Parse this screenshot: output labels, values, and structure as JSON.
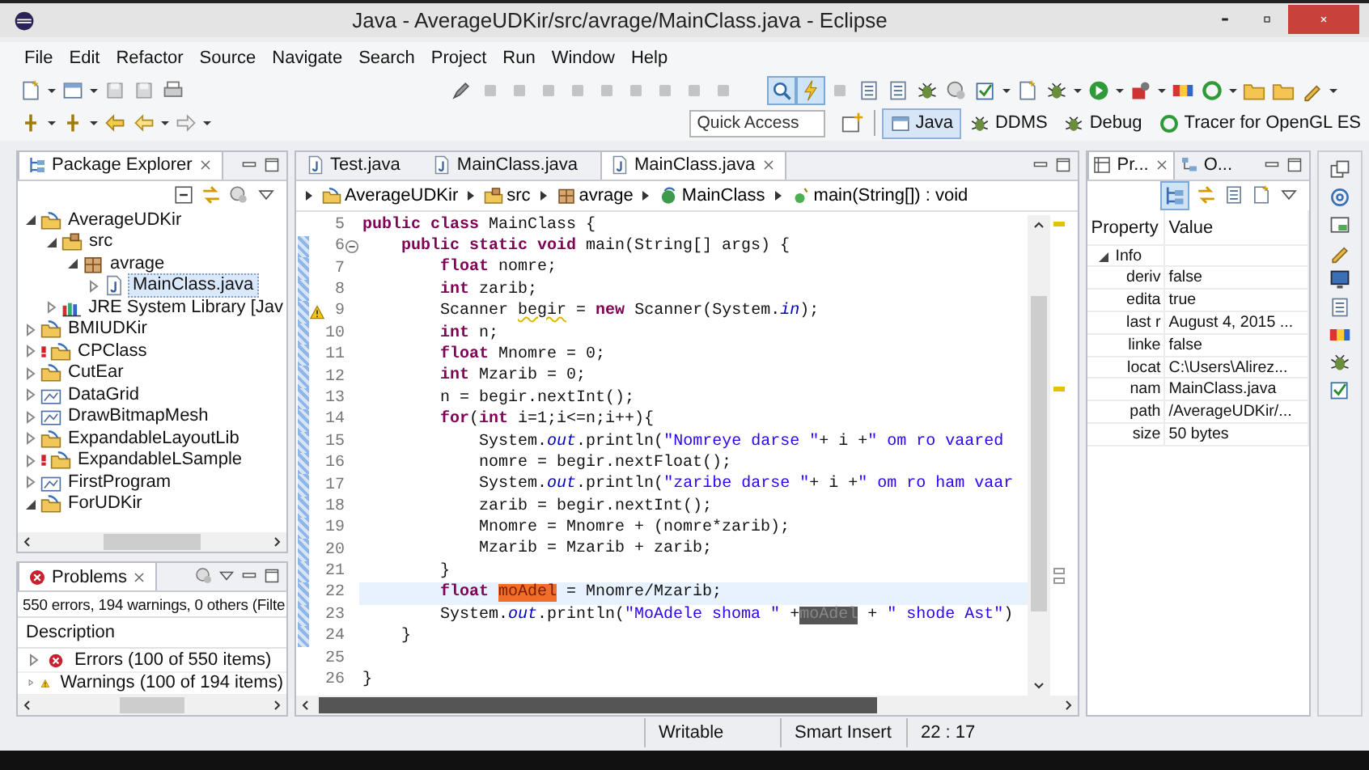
{
  "window": {
    "title": "Java - AverageUDKir/src/avrage/MainClass.java - Eclipse"
  },
  "menu": [
    "File",
    "Edit",
    "Refactor",
    "Source",
    "Navigate",
    "Search",
    "Project",
    "Run",
    "Window",
    "Help"
  ],
  "toolbar": {
    "toggle_buttons": [
      {
        "on": true
      },
      {
        "on": true
      }
    ],
    "quick_access": {
      "placeholder": "Quick Access"
    },
    "perspectives": [
      {
        "label": "Java",
        "selected": true
      },
      {
        "label": "DDMS",
        "selected": false
      },
      {
        "label": "Debug",
        "selected": false
      },
      {
        "label": "Tracer for OpenGL ES",
        "selected": false
      }
    ]
  },
  "package_explorer": {
    "title": "Package Explorer",
    "items": [
      {
        "label": "AverageUDKir",
        "kind": "project",
        "expanded": true,
        "selected": false,
        "error": false,
        "children": [
          {
            "label": "src",
            "kind": "source-folder",
            "expanded": true,
            "selected": false,
            "children": [
              {
                "label": "avrage",
                "kind": "package",
                "expanded": true,
                "selected": false,
                "children": [
                  {
                    "label": "MainClass.java",
                    "kind": "java-file",
                    "expanded": false,
                    "selected": true
                  }
                ]
              }
            ]
          },
          {
            "label": "JRE System Library [Jav",
            "kind": "library",
            "expanded": false,
            "selected": false
          }
        ]
      },
      {
        "label": "BMIUDKir",
        "kind": "project",
        "expanded": false,
        "selected": false,
        "error": false
      },
      {
        "label": "CPClass",
        "kind": "project",
        "expanded": false,
        "selected": false,
        "error": true
      },
      {
        "label": "CutEar",
        "kind": "project",
        "expanded": false,
        "selected": false,
        "error": false
      },
      {
        "label": "DataGrid",
        "kind": "general-project",
        "expanded": false,
        "selected": false,
        "error": false
      },
      {
        "label": "DrawBitmapMesh",
        "kind": "general-project",
        "expanded": false,
        "selected": false,
        "error": false
      },
      {
        "label": "ExpandableLayoutLib",
        "kind": "project",
        "expanded": false,
        "selected": false,
        "error": false
      },
      {
        "label": "ExpandableLSample",
        "kind": "project",
        "expanded": false,
        "selected": false,
        "error": true
      },
      {
        "label": "FirstProgram",
        "kind": "general-project",
        "expanded": false,
        "selected": false,
        "error": false
      },
      {
        "label": "ForUDKir",
        "kind": "project",
        "expanded": true,
        "selected": false,
        "error": false
      }
    ]
  },
  "problems": {
    "title": "Problems",
    "summary": "550 errors, 194 warnings, 0 others (Filte",
    "column": "Description",
    "rows": [
      {
        "kind": "error",
        "label": "Errors (100 of 550 items)",
        "expanded": false
      },
      {
        "kind": "warning",
        "label": "Warnings (100 of 194 items)",
        "expanded": false
      }
    ]
  },
  "editor": {
    "tabs": [
      {
        "label": "Test.java",
        "selected": false
      },
      {
        "label": "MainClass.java",
        "selected": false
      },
      {
        "label": "MainClass.java",
        "selected": true
      }
    ],
    "breadcrumb": [
      {
        "label": "AverageUDKir",
        "kind": "project"
      },
      {
        "label": "src",
        "kind": "source-folder"
      },
      {
        "label": "avrage",
        "kind": "package"
      },
      {
        "label": "MainClass",
        "kind": "class"
      },
      {
        "label": "main(String[]) : void",
        "kind": "method"
      }
    ],
    "lines": [
      {
        "number": "5",
        "changed": false,
        "current": false,
        "warning": false,
        "fold": false,
        "tokens": [
          {
            "kind": "keyword",
            "text": "public class"
          },
          {
            "kind": "plain",
            "text": " MainClass {"
          }
        ]
      },
      {
        "number": "6",
        "changed": true,
        "current": false,
        "warning": false,
        "fold": true,
        "tokens": [
          {
            "kind": "keyword",
            "text": "    public static void"
          },
          {
            "kind": "plain",
            "text": " main(String[] args) {"
          }
        ]
      },
      {
        "number": "7",
        "changed": true,
        "current": false,
        "warning": false,
        "fold": false,
        "tokens": [
          {
            "kind": "keyword",
            "text": "        float"
          },
          {
            "kind": "plain",
            "text": " nomre;"
          }
        ]
      },
      {
        "number": "8",
        "changed": true,
        "current": false,
        "warning": false,
        "fold": false,
        "tokens": [
          {
            "kind": "keyword",
            "text": "        int"
          },
          {
            "kind": "plain",
            "text": " zarib;"
          }
        ]
      },
      {
        "number": "9",
        "changed": true,
        "current": false,
        "warning": true,
        "fold": false,
        "tokens": [
          {
            "kind": "plain",
            "text": "        Scanner "
          },
          {
            "kind": "unused",
            "text": "begir"
          },
          {
            "kind": "plain",
            "text": " = "
          },
          {
            "kind": "keyword",
            "text": "new"
          },
          {
            "kind": "plain",
            "text": " Scanner(System."
          },
          {
            "kind": "static",
            "text": "in"
          },
          {
            "kind": "plain",
            "text": ");"
          }
        ]
      },
      {
        "number": "10",
        "changed": true,
        "current": false,
        "warning": false,
        "fold": false,
        "tokens": [
          {
            "kind": "keyword",
            "text": "        int"
          },
          {
            "kind": "plain",
            "text": " n;"
          }
        ]
      },
      {
        "number": "11",
        "changed": true,
        "current": false,
        "warning": false,
        "fold": false,
        "tokens": [
          {
            "kind": "keyword",
            "text": "        float"
          },
          {
            "kind": "plain",
            "text": " Mnomre = 0;"
          }
        ]
      },
      {
        "number": "12",
        "changed": true,
        "current": false,
        "warning": false,
        "fold": false,
        "tokens": [
          {
            "kind": "keyword",
            "text": "        int"
          },
          {
            "kind": "plain",
            "text": " Mzarib = 0;"
          }
        ]
      },
      {
        "number": "13",
        "changed": true,
        "current": false,
        "warning": false,
        "fold": false,
        "tokens": [
          {
            "kind": "plain",
            "text": "        n = begir.nextInt();"
          }
        ]
      },
      {
        "number": "14",
        "changed": true,
        "current": false,
        "warning": false,
        "fold": false,
        "tokens": [
          {
            "kind": "keyword",
            "text": "        for"
          },
          {
            "kind": "plain",
            "text": "("
          },
          {
            "kind": "keyword",
            "text": "int"
          },
          {
            "kind": "plain",
            "text": " i=1;i<=n;i++){"
          }
        ]
      },
      {
        "number": "15",
        "changed": true,
        "current": false,
        "warning": false,
        "fold": false,
        "tokens": [
          {
            "kind": "plain",
            "text": "            System."
          },
          {
            "kind": "static",
            "text": "out"
          },
          {
            "kind": "plain",
            "text": ".println("
          },
          {
            "kind": "string",
            "text": "\"Nomreye darse \""
          },
          {
            "kind": "plain",
            "text": "+ i +"
          },
          {
            "kind": "string",
            "text": "\" om ro vaared"
          }
        ]
      },
      {
        "number": "16",
        "changed": true,
        "current": false,
        "warning": false,
        "fold": false,
        "tokens": [
          {
            "kind": "plain",
            "text": "            nomre = begir.nextFloat();"
          }
        ]
      },
      {
        "number": "17",
        "changed": true,
        "current": false,
        "warning": false,
        "fold": false,
        "tokens": [
          {
            "kind": "plain",
            "text": "            System."
          },
          {
            "kind": "static",
            "text": "out"
          },
          {
            "kind": "plain",
            "text": ".println("
          },
          {
            "kind": "string",
            "text": "\"zaribe darse \""
          },
          {
            "kind": "plain",
            "text": "+ i +"
          },
          {
            "kind": "string",
            "text": "\" om ro ham vaar"
          }
        ]
      },
      {
        "number": "18",
        "changed": true,
        "current": false,
        "warning": false,
        "fold": false,
        "tokens": [
          {
            "kind": "plain",
            "text": "            zarib = begir.nextInt();"
          }
        ]
      },
      {
        "number": "19",
        "changed": true,
        "current": false,
        "warning": false,
        "fold": false,
        "tokens": [
          {
            "kind": "plain",
            "text": "            Mnomre = Mnomre + (nomre*zarib);"
          }
        ]
      },
      {
        "number": "20",
        "changed": true,
        "current": false,
        "warning": false,
        "fold": false,
        "tokens": [
          {
            "kind": "plain",
            "text": "            Mzarib = Mzarib + zarib;"
          }
        ]
      },
      {
        "number": "21",
        "changed": true,
        "current": false,
        "warning": false,
        "fold": false,
        "tokens": [
          {
            "kind": "plain",
            "text": "        }"
          }
        ]
      },
      {
        "number": "22",
        "changed": true,
        "current": true,
        "warning": false,
        "fold": false,
        "tokens": [
          {
            "kind": "keyword",
            "text": "        float "
          },
          {
            "kind": "write-occurrence",
            "text": "moAdel"
          },
          {
            "kind": "plain",
            "text": " = Mnomre/Mzarib;"
          }
        ]
      },
      {
        "number": "23",
        "changed": true,
        "current": false,
        "warning": false,
        "fold": false,
        "tokens": [
          {
            "kind": "plain",
            "text": "        System."
          },
          {
            "kind": "static",
            "text": "out"
          },
          {
            "kind": "plain",
            "text": ".println("
          },
          {
            "kind": "string",
            "text": "\"MoAdele shoma \""
          },
          {
            "kind": "plain",
            "text": " +"
          },
          {
            "kind": "read-occurrence",
            "text": "moAdel"
          },
          {
            "kind": "plain",
            "text": " + "
          },
          {
            "kind": "string",
            "text": "\" shode Ast\""
          },
          {
            "kind": "plain",
            "text": ")"
          }
        ]
      },
      {
        "number": "24",
        "changed": true,
        "current": false,
        "warning": false,
        "fold": false,
        "tokens": [
          {
            "kind": "plain",
            "text": "    }"
          }
        ]
      },
      {
        "number": "25",
        "changed": false,
        "current": false,
        "warning": false,
        "fold": false
      },
      {
        "number": "26",
        "changed": false,
        "current": false,
        "warning": false,
        "fold": false,
        "tokens": [
          {
            "kind": "plain",
            "text": "}"
          }
        ]
      }
    ]
  },
  "properties": {
    "tabs": [
      {
        "label": "Pr...",
        "selected": true
      },
      {
        "label": "O...",
        "selected": false
      }
    ],
    "columns": [
      "Property",
      "Value"
    ],
    "group": {
      "label": "Info",
      "expanded": true
    },
    "rows": [
      {
        "property": "deriv",
        "value": "false"
      },
      {
        "property": "edita",
        "value": "true"
      },
      {
        "property": "last r",
        "value": "August 4, 2015 ..."
      },
      {
        "property": "linke",
        "value": "false"
      },
      {
        "property": "locat",
        "value": "C:\\Users\\Alirez..."
      },
      {
        "property": "nam",
        "value": "MainClass.java"
      },
      {
        "property": "path",
        "value": "/AverageUDKir/..."
      },
      {
        "property": "size",
        "value": "50  bytes"
      }
    ]
  },
  "status_bar": [
    "Writable",
    "Smart Insert",
    "22 : 17"
  ]
}
